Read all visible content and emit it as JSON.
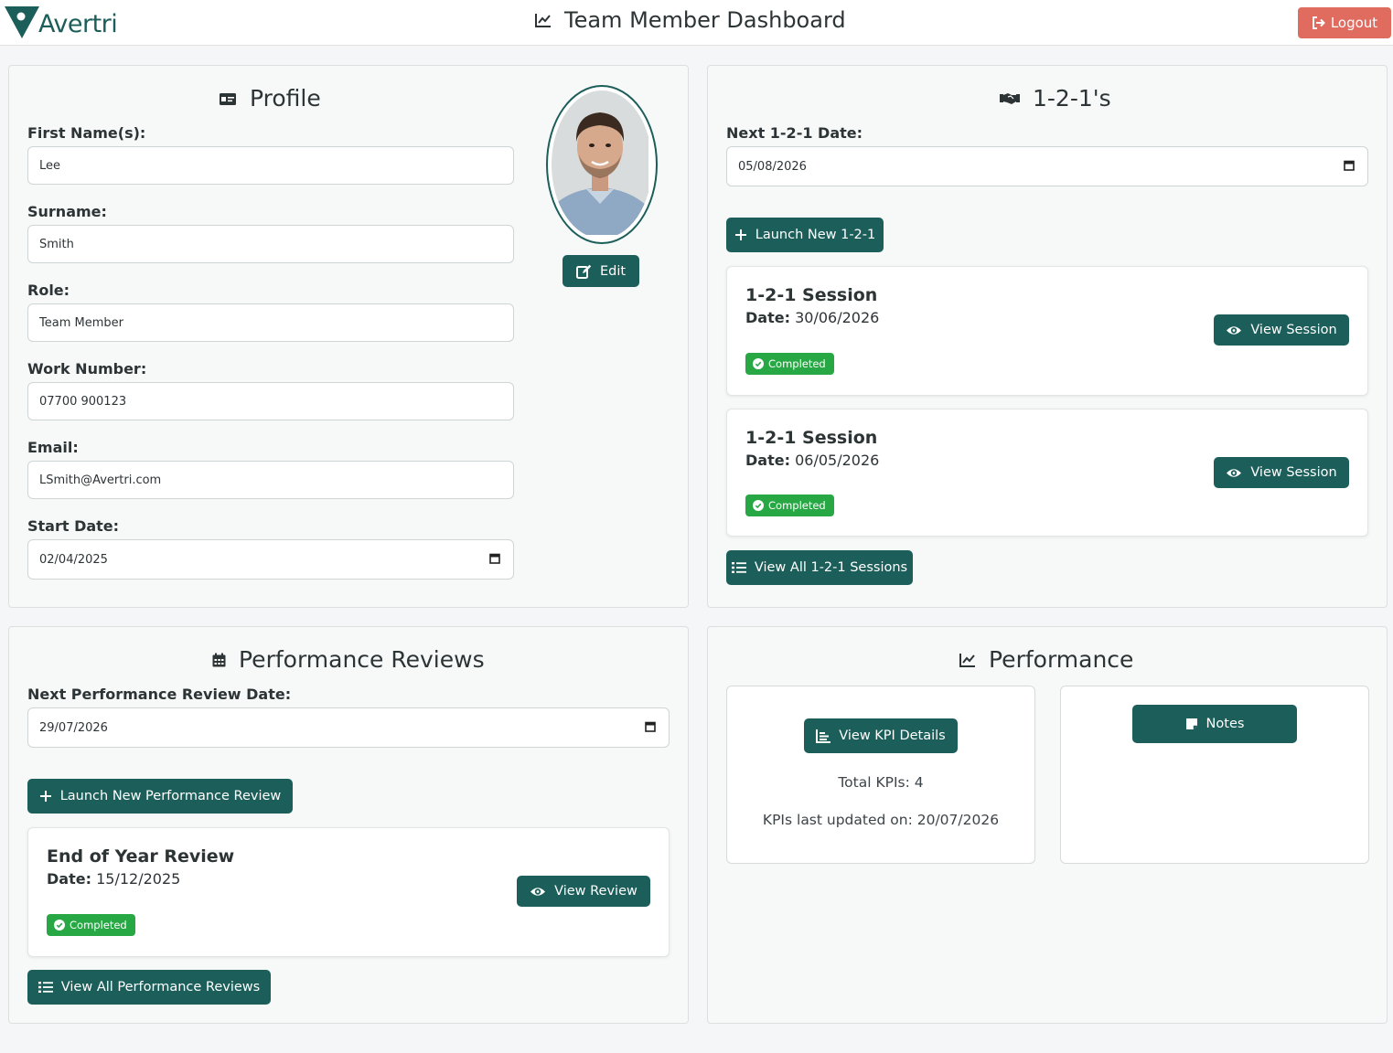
{
  "header": {
    "logo_text": "Avertri",
    "title": "Team Member Dashboard",
    "logout_label": "Logout"
  },
  "profile": {
    "title": "Profile",
    "fields": [
      {
        "label": "First Name(s):",
        "value": "Lee"
      },
      {
        "label": "Surname:",
        "value": "Smith"
      },
      {
        "label": "Role:",
        "value": "Team Member"
      },
      {
        "label": "Work Number:",
        "value": "07700 900123"
      },
      {
        "label": "Email:",
        "value": "LSmith@Avertri.com"
      },
      {
        "label": "Start Date:",
        "value": "02/04/2025"
      }
    ],
    "edit_label": "Edit"
  },
  "one_to_ones": {
    "title": "1-2-1's",
    "next_date_label": "Next 1-2-1 Date:",
    "next_date_value": "05/08/2026",
    "launch_label": "Launch New 1-2-1",
    "sessions": [
      {
        "title": "1-2-1 Session",
        "date_label": "Date:",
        "date": "30/06/2026",
        "status": "Completed",
        "action": "View Session"
      },
      {
        "title": "1-2-1 Session",
        "date_label": "Date:",
        "date": "06/05/2026",
        "status": "Completed",
        "action": "View Session"
      }
    ],
    "view_all_label": "View All 1-2-1 Sessions"
  },
  "reviews": {
    "title": "Performance Reviews",
    "next_date_label": "Next Performance Review Date:",
    "next_date_value": "29/07/2026",
    "launch_label": "Launch New Performance Review",
    "items": [
      {
        "title": "End of Year Review",
        "date_label": "Date:",
        "date": "15/12/2025",
        "status": "Completed",
        "action": "View Review"
      }
    ],
    "view_all_label": "View All Performance Reviews"
  },
  "performance": {
    "title": "Performance",
    "kpi_button": "View KPI Details",
    "total_kpis": "Total KPIs: 4",
    "kpis_updated": "KPIs last updated on: 20/07/2026",
    "notes_button": "Notes"
  },
  "colors": {
    "accent": "#1b5e5a",
    "logout": "#e06b5f",
    "success": "#27a844"
  }
}
